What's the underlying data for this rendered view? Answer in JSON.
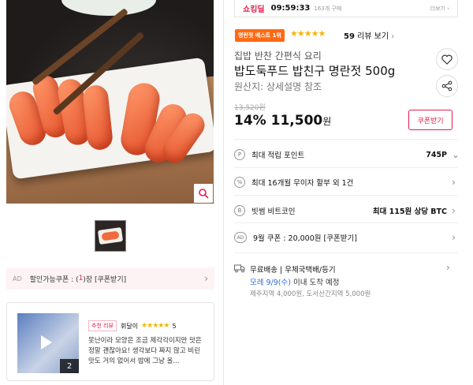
{
  "colors": {
    "accent": "#e41d4c",
    "best_badge": "#ff6a13",
    "star": "#f7b500",
    "link_blue": "#2f6bd9"
  },
  "gallery": {
    "zoom_icon": "magnifier-icon"
  },
  "ad_banner": {
    "ad_label": "AD",
    "text_before": "할인가능쿠폰 : (",
    "count": "1",
    "text_after": ")장 [쿠폰받기]"
  },
  "review_card": {
    "photo_count": "2",
    "badge": "추천 리뷰",
    "user": "휘달이",
    "stars": "★★★★★",
    "score": "5",
    "text": "못난이라 모양은 조금 제각각이지만 맛은 정말 괜찮아요! 생각보다 짜지 않고 비린 맛도 거의 없어서 밥에 그냥 올..."
  },
  "topbar": {
    "shock_label": "쇼킹딜",
    "time": "09:59:33",
    "count": "163개 구매",
    "more": "더보기 ›"
  },
  "product": {
    "best_badge": "명란젓 베스트 1위",
    "stars": "★★★★★",
    "review_count": "59",
    "review_label": " 리뷰 보기",
    "subtitle": "집밥 반찬 간편식 요리",
    "title": "밥도둑푸드 밥친구 명란젓 500g",
    "origin": "원산지: 상세설명 참조",
    "old_price": "13,520원",
    "discount": "14%",
    "price": "11,500",
    "won": "원",
    "coupon_btn": "쿠폰받기"
  },
  "benefits": [
    {
      "icon": "P",
      "label": "최대 적립 포인트",
      "value": "745P"
    },
    {
      "icon": "%",
      "label": "최대 16개월 무이자 할부 외 1건",
      "value": ""
    },
    {
      "icon": "B",
      "label": "빗썸 비트코인",
      "value": "최대 115원 상당 BTC"
    },
    {
      "icon": "AD",
      "label": "9월 쿠폰 : 20,000원 [쿠폰받기]",
      "value": ""
    }
  ],
  "shipping": {
    "line1": "무료배송 | 우체국택배/등기",
    "arrival_date": "모레 9/9(수)",
    "arrival_rest": " 이내 도착 예정",
    "extra": "제주지역 4,000원, 도서산간지역 5,000원"
  }
}
